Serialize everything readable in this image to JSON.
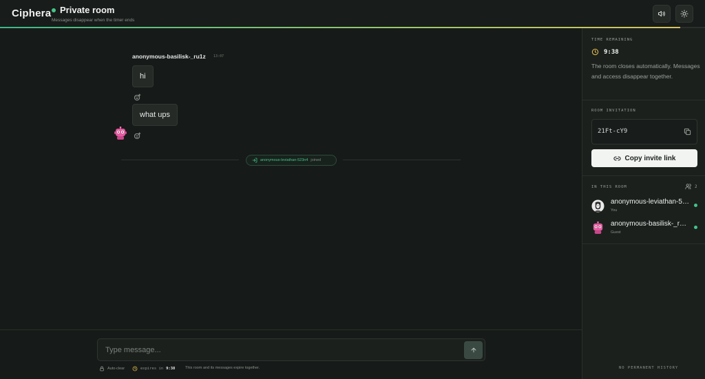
{
  "header": {
    "brand": "Ciphera",
    "room_title": "Private room",
    "room_subtitle": "Messages disappear when the timer ends",
    "sound_button": "speaker-icon",
    "theme_button": "sun-icon"
  },
  "timer_progress": 0.965,
  "colors": {
    "accent": "#43c48a",
    "background": "#161a18",
    "sidebar": "#1b201d",
    "bubble": "#252a27"
  },
  "chat": {
    "sender": "anonymous-basilisk-_ru1z",
    "time": "13:07",
    "messages": [
      "hi",
      "what ups"
    ],
    "system_event": {
      "name": "anonymous-leviathan-523n4",
      "action": "joined"
    }
  },
  "composer": {
    "placeholder": "Type message...",
    "value": "",
    "auto_clear": "Auto-clear",
    "expires_label": "expires in",
    "expires_value": "9:38",
    "note": "This room and its messages expire together."
  },
  "sidebar": {
    "time_remaining_label": "TIME REMAINING",
    "time_remaining_value": "9:38",
    "time_remaining_desc": "The room closes automatically. Messages and access disappear together.",
    "invitation_label": "ROOM INVITATION",
    "invite_code": "21Ft-cY9",
    "copy_invite_label": "Copy invite link",
    "in_room_label": "IN THIS ROOM",
    "member_count": "2",
    "members": [
      {
        "name": "anonymous-leviathan-523n4",
        "role": "You",
        "status": "online"
      },
      {
        "name": "anonymous-basilisk-_ru1z",
        "role": "Guest",
        "status": "online"
      }
    ],
    "no_history": "NO PERMANENT HISTORY"
  }
}
